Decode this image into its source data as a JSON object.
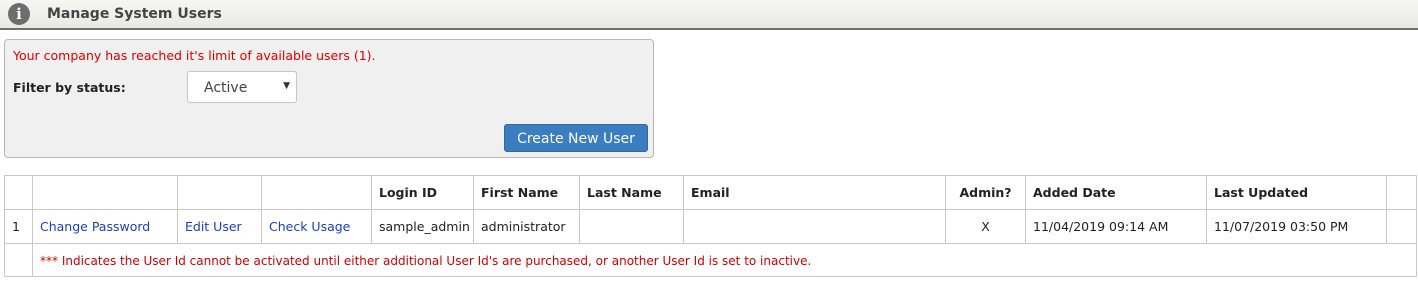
{
  "header": {
    "title": "Manage System Users",
    "icon": "info-icon"
  },
  "panel": {
    "limit_message": "Your company has reached it's limit of available users (1).",
    "filter_label": "Filter by status:",
    "status_select": {
      "value": "Active"
    },
    "create_button": "Create New User"
  },
  "table": {
    "columns": [
      "",
      "",
      "",
      "",
      "Login ID",
      "First Name",
      "Last Name",
      "Email",
      "Admin?",
      "Added Date",
      "Last Updated",
      ""
    ],
    "rows": [
      {
        "num": "1",
        "change_password": "Change Password",
        "edit_user": "Edit User",
        "check_usage": "Check Usage",
        "login_id": "sample_admin",
        "first_name": "administrator",
        "last_name": "",
        "email": "",
        "admin": "X",
        "added_date": "11/04/2019 09:14 AM",
        "last_updated": "11/07/2019 03:50 PM"
      }
    ],
    "note": "*** Indicates the User Id cannot be activated until either additional User Id's are purchased, or another User Id is set to inactive."
  }
}
